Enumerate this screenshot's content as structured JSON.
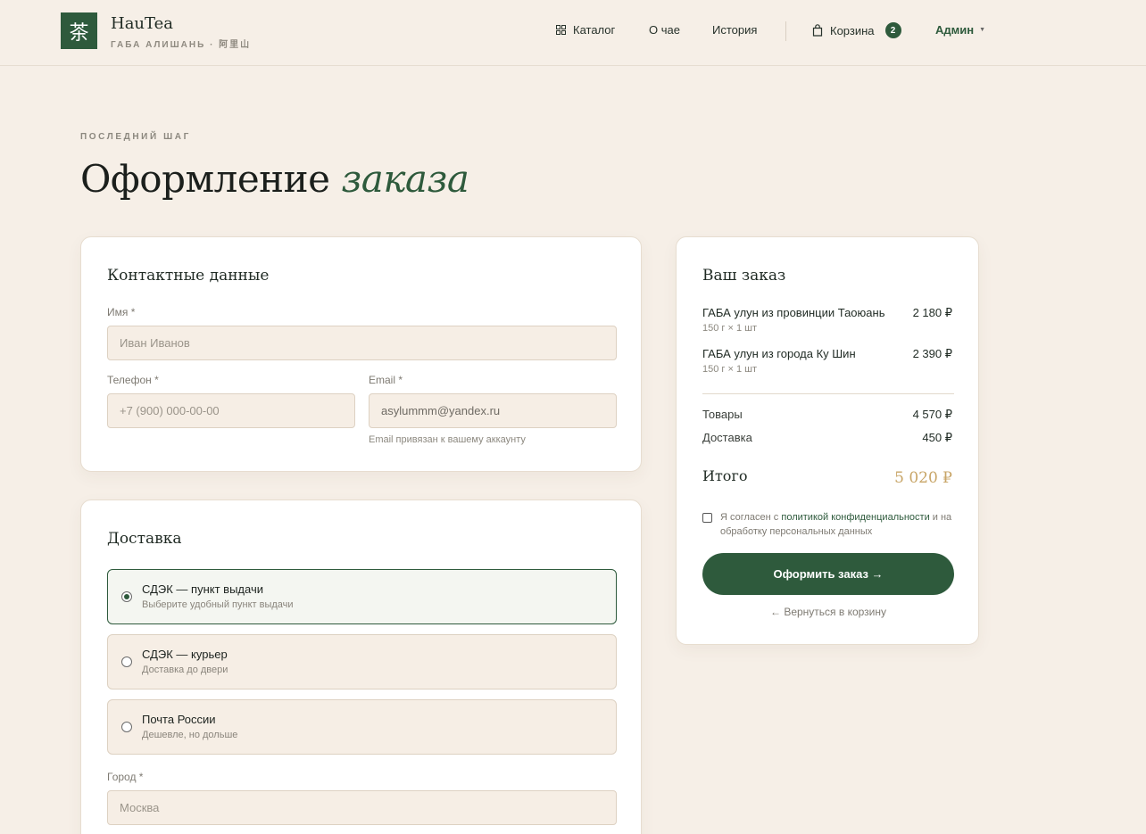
{
  "header": {
    "logo_glyph": "茶",
    "brand_name": "HauTea",
    "brand_sub": "ГАБА АЛИШАНЬ · 阿里山",
    "nav": {
      "catalog": "Каталог",
      "about": "О чае",
      "history": "История",
      "cart": "Корзина",
      "cart_count": "2",
      "admin": "Админ"
    }
  },
  "page": {
    "eyebrow": "ПОСЛЕДНИЙ ШАГ",
    "title_main": "Оформление ",
    "title_accent": "заказа"
  },
  "contact": {
    "title": "Контактные данные",
    "name_label": "Имя *",
    "name_placeholder": "Иван Иванов",
    "phone_label": "Телефон *",
    "phone_placeholder": "+7 (900) 000-00-00",
    "email_label": "Email *",
    "email_value": "asylummm@yandex.ru",
    "email_hint": "Email привязан к вашему аккаунту"
  },
  "delivery": {
    "title": "Доставка",
    "options": [
      {
        "title": "СДЭК — пункт выдачи",
        "sub": "Выберите удобный пункт выдачи",
        "selected": true
      },
      {
        "title": "СДЭК — курьер",
        "sub": "Доставка до двери",
        "selected": false
      },
      {
        "title": "Почта России",
        "sub": "Дешевле, но дольше",
        "selected": false
      }
    ],
    "city_label": "Город *",
    "city_placeholder": "Москва"
  },
  "summary": {
    "title": "Ваш заказ",
    "items": [
      {
        "name": "ГАБА улун из провинции Таоюань",
        "meta": "150 г × 1 шт",
        "price": "2 180 ₽"
      },
      {
        "name": "ГАБА улун из города Ку Шин",
        "meta": "150 г × 1 шт",
        "price": "2 390 ₽"
      }
    ],
    "goods_label": "Товары",
    "goods_value": "4 570 ₽",
    "delivery_label": "Доставка",
    "delivery_value": "450 ₽",
    "total_label": "Итого",
    "total_value": "5 020 ₽",
    "consent_prefix": "Я согласен с ",
    "consent_link": "политикой конфиденциальности",
    "consent_suffix": " и на обработку персональных данных",
    "submit": "Оформить заказ →",
    "back": "← Вернуться в корзину"
  },
  "colors": {
    "accent": "#2e5a3c",
    "background": "#f6efe7",
    "total": "#c8a567"
  }
}
